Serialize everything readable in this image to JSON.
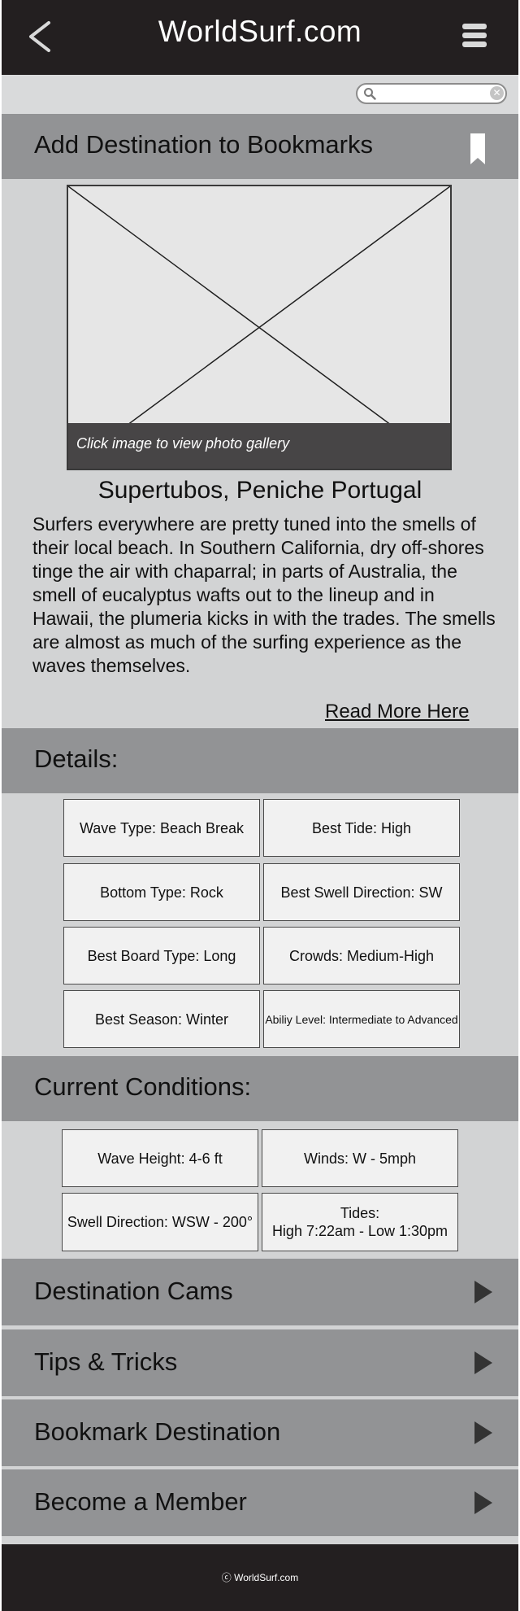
{
  "header": {
    "title": "WorldSurf.com",
    "back_icon": "chevron-left-icon",
    "menu_icon": "hamburger-menu-icon"
  },
  "search": {
    "placeholder": "",
    "value": ""
  },
  "bookmark_bar": {
    "title": "Add Destination to Bookmarks",
    "icon": "bookmark-icon"
  },
  "gallery": {
    "caption": "Click image to view photo gallery"
  },
  "destination": {
    "name": "Supertubos, Peniche Portugal",
    "description": "Surfers everywhere are pretty tuned into the smells of their local beach. In Southern California, dry off-shores tinge the air with chaparral; in parts of Australia, the smell of eucalyptus wafts out to the lineup and in Hawaii, the plumeria kicks in with the trades. The smells are almost as much of the surfing experience as the waves themselves.",
    "read_more": "Read More Here"
  },
  "details": {
    "title": "Details:",
    "items": [
      "Wave Type: Beach Break",
      "Best Tide: High",
      "Bottom Type: Rock",
      "Best Swell Direction: SW",
      "Best Board Type: Long",
      "Crowds: Medium-High",
      "Best Season: Winter",
      "Abiliy Level: Intermediate to Advanced"
    ]
  },
  "conditions": {
    "title": "Current Conditions:",
    "items": [
      "Wave Height: 4-6 ft",
      "Winds: W - 5mph",
      "Swell Direction: WSW - 200°",
      "Tides:\nHigh 7:22am - Low 1:30pm"
    ]
  },
  "nav": [
    {
      "label": "Destination Cams"
    },
    {
      "label": "Tips & Tricks"
    },
    {
      "label": "Bookmark Destination"
    },
    {
      "label": "Become a Member"
    }
  ],
  "footer": {
    "text": "ⓒ WorldSurf.com"
  },
  "colors": {
    "header_bg": "#231f20",
    "page_bg": "#d2d3d4",
    "section_bar": "#929395",
    "cell_bg": "#f1f1f1"
  }
}
